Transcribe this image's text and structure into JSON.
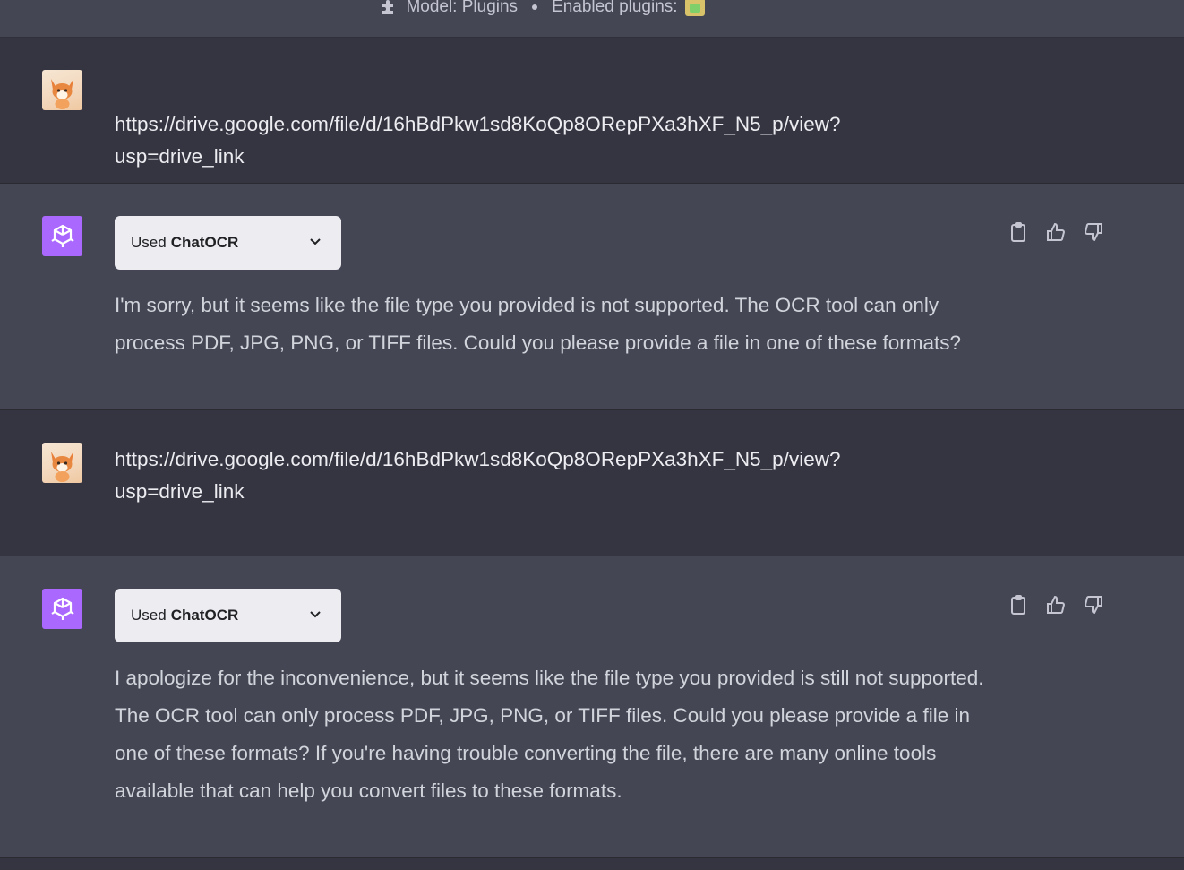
{
  "topbar": {
    "model_label": "Model: Plugins",
    "enabled_label": "Enabled plugins:",
    "icons": [
      "puzzle-icon",
      "plugin-badge-icon"
    ]
  },
  "messages": [
    {
      "role": "user",
      "line1": "https://drive.google.com/file/d/16hBdPkw1sd8KoQp8ORepPXa3hXF_N5_p/view?",
      "line2": "usp=drive_link"
    },
    {
      "role": "assistant",
      "plugin_used": "Used",
      "plugin_name": "ChatOCR",
      "text": "I'm sorry, but it seems like the file type you provided is not supported. The OCR tool can only process PDF, JPG, PNG, or TIFF files. Could you please provide a file in one of these formats?"
    },
    {
      "role": "user",
      "line1": "https://drive.google.com/file/d/16hBdPkw1sd8KoQp8ORepPXa3hXF_N5_p/view?",
      "line2": "usp=drive_link"
    },
    {
      "role": "assistant",
      "plugin_used": "Used",
      "plugin_name": "ChatOCR",
      "text": "I apologize for the inconvenience, but it seems like the file type you provided is still not supported. The OCR tool can only process PDF, JPG, PNG, or TIFF files. Could you please provide a file in one of these formats? If you're having trouble converting the file, there are many online tools available that can help you convert files to these formats."
    }
  ],
  "colors": {
    "user_bg": "#343541",
    "bot_bg": "#444654",
    "gpt_avatar": "#ab68ff",
    "pill_bg": "#ececf1"
  }
}
